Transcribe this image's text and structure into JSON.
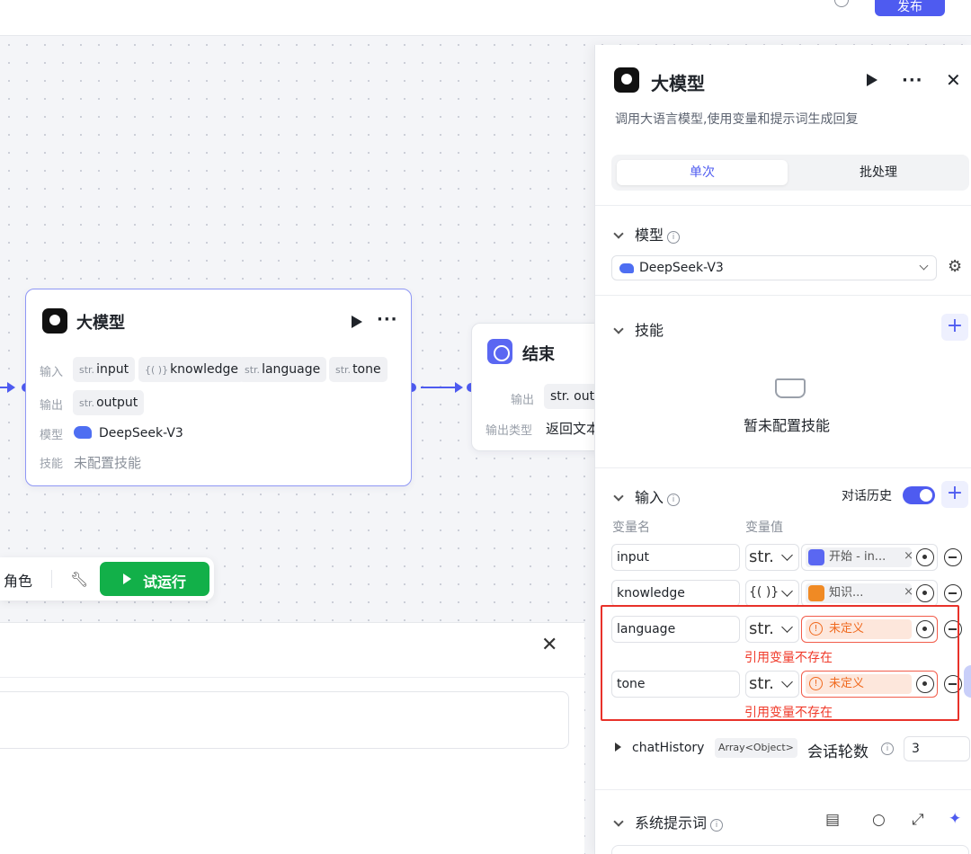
{
  "topbar": {
    "publish_label": "发布"
  },
  "canvas": {
    "llm_node": {
      "title": "大模型",
      "input_label": "输入",
      "inputs": [
        {
          "prefix": "str.",
          "name": "input"
        },
        {
          "prefix": "{( )}",
          "name": "knowledge"
        },
        {
          "prefix": "str.",
          "name": "language"
        },
        {
          "prefix": "str.",
          "name": "tone"
        }
      ],
      "output_label": "输出",
      "output": {
        "prefix": "str.",
        "name": "output"
      },
      "model_label": "模型",
      "model_value": "DeepSeek-V3",
      "skills_label": "技能",
      "skills_value": "未配置技能"
    },
    "end_node": {
      "title": "结束",
      "output_label": "输出",
      "output_chip": "str. outp",
      "output_type_label": "输出类型",
      "output_type_value": "返回文本"
    },
    "toolbar": {
      "role_label": "角色",
      "run_label": "试运行"
    }
  },
  "panel": {
    "title": "大模型",
    "description": "调用大语言模型,使用变量和提示词生成回复",
    "tabs": [
      {
        "label": "单次",
        "active": true
      },
      {
        "label": "批处理",
        "active": false
      }
    ],
    "model_section": {
      "title": "模型",
      "selected": "DeepSeek-V3"
    },
    "skills_section": {
      "title": "技能",
      "empty_text": "暂未配置技能"
    },
    "input_section": {
      "title": "输入",
      "history_label": "对话历史",
      "history_enabled": true,
      "col_name": "变量名",
      "col_value": "变量值",
      "rows": [
        {
          "name": "input",
          "type": "str.",
          "ref_label": "开始 - in...",
          "ref_icon_color": "#5a67f2",
          "error": false,
          "error_text": ""
        },
        {
          "name": "knowledge",
          "type": "{( )}",
          "ref_label": "知识...",
          "ref_icon_color": "#f08a24",
          "error": false,
          "error_text": ""
        },
        {
          "name": "language",
          "type": "str.",
          "ref_label": "未定义",
          "ref_icon_color": "",
          "error": true,
          "error_text": "引用变量不存在"
        },
        {
          "name": "tone",
          "type": "str.",
          "ref_label": "未定义",
          "ref_icon_color": "",
          "error": true,
          "error_text": "引用变量不存在"
        }
      ],
      "chat_history": {
        "name": "chatHistory",
        "type": "Array<Object>",
        "rounds_label": "会话轮数",
        "rounds_value": "3"
      }
    },
    "system_prompt_section": {
      "title": "系统提示词"
    }
  },
  "colors": {
    "accent": "#4e5bf0",
    "run_green": "#12b049",
    "error_red": "#f03a2a",
    "warning_orange": "#f06a1f"
  }
}
